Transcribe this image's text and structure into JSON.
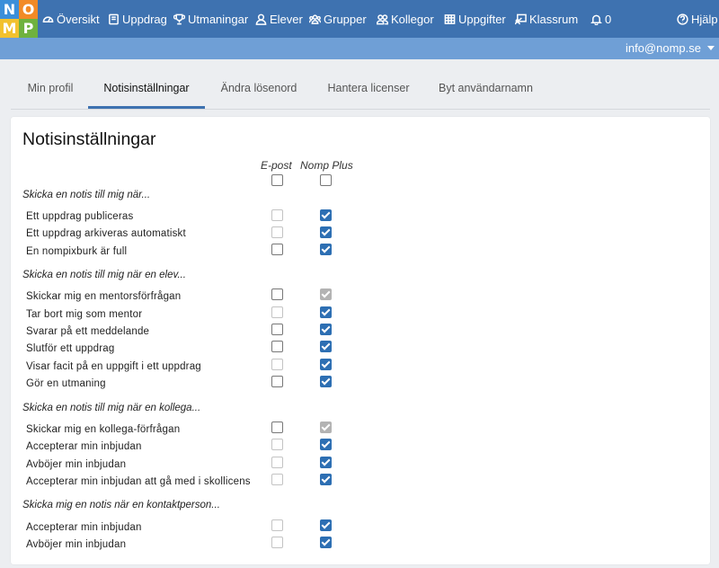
{
  "logo": {
    "letters": [
      "N",
      "O",
      "M",
      "P"
    ]
  },
  "nav": {
    "items": [
      {
        "label": "Översikt",
        "icon": "dashboard-icon"
      },
      {
        "label": "Uppdrag",
        "icon": "book-icon"
      },
      {
        "label": "Utmaningar",
        "icon": "trophy-icon"
      },
      {
        "label": "Elever",
        "icon": "user-icon"
      },
      {
        "label": "Grupper",
        "icon": "users-icon"
      },
      {
        "label": "Kollegor",
        "icon": "user-group-icon"
      },
      {
        "label": "Uppgifter",
        "icon": "grid-icon"
      },
      {
        "label": "Klassrum",
        "icon": "classroom-icon"
      }
    ],
    "notifications_count": "0",
    "help_label": "Hjälp"
  },
  "user": {
    "email": "info@nomp.se"
  },
  "tabs": [
    {
      "label": "Min profil",
      "active": false
    },
    {
      "label": "Notisinställningar",
      "active": true
    },
    {
      "label": "Ändra lösenord",
      "active": false
    },
    {
      "label": "Hantera licenser",
      "active": false
    },
    {
      "label": "Byt användarnamn",
      "active": false
    }
  ],
  "settings": {
    "title": "Notisinställningar",
    "columns": {
      "email": "E-post",
      "plus": "Nomp Plus"
    },
    "select_all": {
      "email": false,
      "plus": false
    },
    "sections": [
      {
        "heading": "Skicka en notis till mig när...",
        "rows": [
          {
            "label": "Ett uppdrag publiceras",
            "email": false,
            "email_disabled": true,
            "plus": true,
            "plus_disabled": false
          },
          {
            "label": "Ett uppdrag arkiveras automatiskt",
            "email": false,
            "email_disabled": true,
            "plus": true,
            "plus_disabled": false
          },
          {
            "label": "En nompixburk är full",
            "email": false,
            "email_disabled": false,
            "plus": true,
            "plus_disabled": false
          }
        ]
      },
      {
        "heading": "Skicka en notis till mig när en elev...",
        "rows": [
          {
            "label": "Skickar mig en mentorsförfrågan",
            "email": false,
            "email_disabled": false,
            "plus": true,
            "plus_disabled": true
          },
          {
            "label": "Tar bort mig som mentor",
            "email": false,
            "email_disabled": true,
            "plus": true,
            "plus_disabled": false
          },
          {
            "label": "Svarar på ett meddelande",
            "email": false,
            "email_disabled": false,
            "plus": true,
            "plus_disabled": false
          },
          {
            "label": "Slutför ett uppdrag",
            "email": false,
            "email_disabled": false,
            "plus": true,
            "plus_disabled": false
          },
          {
            "label": "Visar facit på en uppgift i ett uppdrag",
            "email": false,
            "email_disabled": true,
            "plus": true,
            "plus_disabled": false
          },
          {
            "label": "Gör en utmaning",
            "email": false,
            "email_disabled": false,
            "plus": true,
            "plus_disabled": false
          }
        ]
      },
      {
        "heading": "Skicka en notis till mig när en kollega...",
        "rows": [
          {
            "label": "Skickar mig en kollega-förfrågan",
            "email": false,
            "email_disabled": false,
            "plus": true,
            "plus_disabled": true
          },
          {
            "label": "Accepterar min inbjudan",
            "email": false,
            "email_disabled": true,
            "plus": true,
            "plus_disabled": false
          },
          {
            "label": "Avböjer min inbjudan",
            "email": false,
            "email_disabled": true,
            "plus": true,
            "plus_disabled": false
          },
          {
            "label": "Accepterar min inbjudan att gå med i skollicens",
            "email": false,
            "email_disabled": true,
            "plus": true,
            "plus_disabled": false
          }
        ]
      },
      {
        "heading": "Skicka mig en notis när en kontaktperson...",
        "rows": [
          {
            "label": "Accepterar min inbjudan",
            "email": false,
            "email_disabled": true,
            "plus": true,
            "plus_disabled": false
          },
          {
            "label": "Avböjer min inbjudan",
            "email": false,
            "email_disabled": true,
            "plus": true,
            "plus_disabled": false
          }
        ]
      }
    ]
  }
}
